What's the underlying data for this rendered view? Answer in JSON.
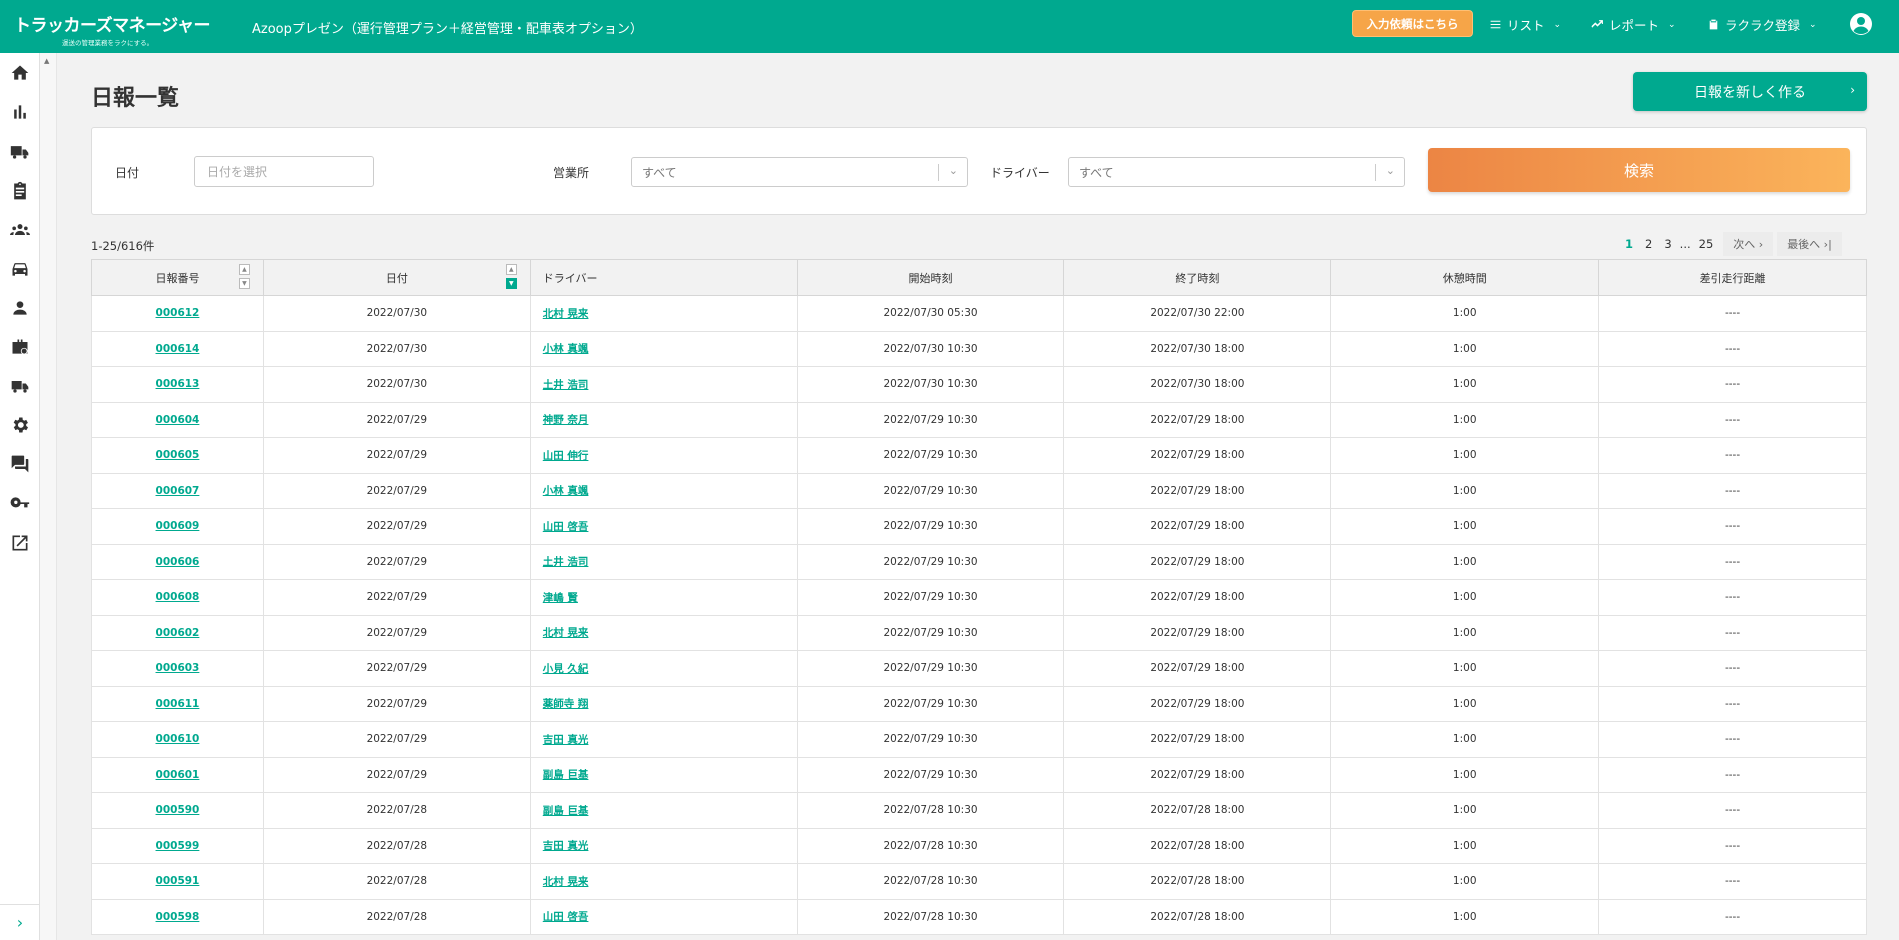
{
  "header": {
    "logo_text": "トラッカーズマネージャー",
    "logo_tagline": "運送の管理業務をラクにする。",
    "app_title": "Azoopプレゼン（運行管理プラン＋経営管理・配車表オプション）",
    "cta_label": "入力依頼はこちら",
    "menus": [
      {
        "label": "リスト",
        "icon": "list-icon"
      },
      {
        "label": "レポート",
        "icon": "trending-icon"
      },
      {
        "label": "ラクラク登録",
        "icon": "clipboard-icon"
      }
    ],
    "user_icon": "account-circle-icon"
  },
  "sidebar": {
    "items": [
      "home-icon",
      "bar-chart-icon",
      "truck-icon",
      "clipboard-icon",
      "group-icon",
      "car-icon",
      "person-icon",
      "briefcase-icon",
      "delivery-truck-icon",
      "settings-icon",
      "forum-icon",
      "key-icon",
      "open-external-icon"
    ],
    "expand_label": "›"
  },
  "page": {
    "title": "日報一覧",
    "new_button": "日報を新しく作る",
    "new_button_arrow": "›"
  },
  "filters": {
    "date_label": "日付",
    "date_placeholder": "日付を選択",
    "office_label": "営業所",
    "office_value": "すべて",
    "driver_label": "ドライバー",
    "driver_value": "すべて",
    "search_label": "検索"
  },
  "list": {
    "count_text": "1-25/616件",
    "pagination": {
      "pages": [
        "1",
        "2",
        "3",
        "...",
        "25"
      ],
      "current": "1",
      "next": "次へ ›",
      "last": "最後へ ›|"
    }
  },
  "table": {
    "columns": [
      "日報番号",
      "日付",
      "ドライバー",
      "開始時刻",
      "終了時刻",
      "休憩時間",
      "差引走行距離"
    ],
    "rows": [
      {
        "id": "000612",
        "date": "2022/07/30",
        "driver": "北村 晃来",
        "start": "2022/07/30 05:30",
        "end": "2022/07/30 22:00",
        "break": "1:00",
        "distance": "----"
      },
      {
        "id": "000614",
        "date": "2022/07/30",
        "driver": "小林 真颯",
        "start": "2022/07/30 10:30",
        "end": "2022/07/30 18:00",
        "break": "1:00",
        "distance": "----"
      },
      {
        "id": "000613",
        "date": "2022/07/30",
        "driver": "土井 浩司",
        "start": "2022/07/30 10:30",
        "end": "2022/07/30 18:00",
        "break": "1:00",
        "distance": "----"
      },
      {
        "id": "000604",
        "date": "2022/07/29",
        "driver": "神野 奈月",
        "start": "2022/07/29 10:30",
        "end": "2022/07/29 18:00",
        "break": "1:00",
        "distance": "----"
      },
      {
        "id": "000605",
        "date": "2022/07/29",
        "driver": "山田 伸行",
        "start": "2022/07/29 10:30",
        "end": "2022/07/29 18:00",
        "break": "1:00",
        "distance": "----"
      },
      {
        "id": "000607",
        "date": "2022/07/29",
        "driver": "小林 真颯",
        "start": "2022/07/29 10:30",
        "end": "2022/07/29 18:00",
        "break": "1:00",
        "distance": "----"
      },
      {
        "id": "000609",
        "date": "2022/07/29",
        "driver": "山田 啓吾",
        "start": "2022/07/29 10:30",
        "end": "2022/07/29 18:00",
        "break": "1:00",
        "distance": "----"
      },
      {
        "id": "000606",
        "date": "2022/07/29",
        "driver": "土井 浩司",
        "start": "2022/07/29 10:30",
        "end": "2022/07/29 18:00",
        "break": "1:00",
        "distance": "----"
      },
      {
        "id": "000608",
        "date": "2022/07/29",
        "driver": "津嶋 賢",
        "start": "2022/07/29 10:30",
        "end": "2022/07/29 18:00",
        "break": "1:00",
        "distance": "----"
      },
      {
        "id": "000602",
        "date": "2022/07/29",
        "driver": "北村 晃来",
        "start": "2022/07/29 10:30",
        "end": "2022/07/29 18:00",
        "break": "1:00",
        "distance": "----"
      },
      {
        "id": "000603",
        "date": "2022/07/29",
        "driver": "小見 久紀",
        "start": "2022/07/29 10:30",
        "end": "2022/07/29 18:00",
        "break": "1:00",
        "distance": "----"
      },
      {
        "id": "000611",
        "date": "2022/07/29",
        "driver": "薬師寺 翔",
        "start": "2022/07/29 10:30",
        "end": "2022/07/29 18:00",
        "break": "1:00",
        "distance": "----"
      },
      {
        "id": "000610",
        "date": "2022/07/29",
        "driver": "吉田 真光",
        "start": "2022/07/29 10:30",
        "end": "2022/07/29 18:00",
        "break": "1:00",
        "distance": "----"
      },
      {
        "id": "000601",
        "date": "2022/07/29",
        "driver": "副島 巨基",
        "start": "2022/07/29 10:30",
        "end": "2022/07/29 18:00",
        "break": "1:00",
        "distance": "----"
      },
      {
        "id": "000590",
        "date": "2022/07/28",
        "driver": "副島 巨基",
        "start": "2022/07/28 10:30",
        "end": "2022/07/28 18:00",
        "break": "1:00",
        "distance": "----"
      },
      {
        "id": "000599",
        "date": "2022/07/28",
        "driver": "吉田 真光",
        "start": "2022/07/28 10:30",
        "end": "2022/07/28 18:00",
        "break": "1:00",
        "distance": "----"
      },
      {
        "id": "000591",
        "date": "2022/07/28",
        "driver": "北村 晃来",
        "start": "2022/07/28 10:30",
        "end": "2022/07/28 18:00",
        "break": "1:00",
        "distance": "----"
      },
      {
        "id": "000598",
        "date": "2022/07/28",
        "driver": "山田 啓吾",
        "start": "2022/07/28 10:30",
        "end": "2022/07/28 18:00",
        "break": "1:00",
        "distance": "----"
      }
    ]
  },
  "colors": {
    "brand": "#00a98f",
    "accent_orange": "#f6a548",
    "search_gradient_start": "#ec8544",
    "search_gradient_end": "#fbb45b"
  }
}
